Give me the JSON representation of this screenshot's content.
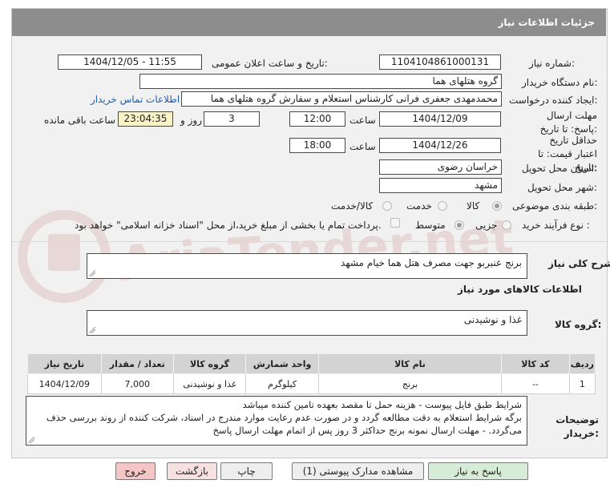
{
  "header": {
    "title": "جزئیات اطلاعات نیاز"
  },
  "fields": {
    "need_number": {
      "label": "شماره نیاز:",
      "value": "1104104861000131"
    },
    "announce_datetime": {
      "label": "تاریخ و ساعت اعلان عمومی:",
      "value": "1404/12/05 - 11:55"
    },
    "buyer_org": {
      "label": "نام دستگاه خریدار:",
      "value": "گروه هتلهای هما"
    },
    "requester": {
      "label": "ایجاد کننده درخواست:",
      "value": "محمدمهدی جعفری فرانی کارشناس استعلام و سفارش گروه هتلهای هما",
      "contact_link": "اطلاعات تماس خریدار"
    },
    "deadline": {
      "label": "مهلت ارسال پاسخ: تا تاریخ:",
      "date": "1404/12/09",
      "time_label": "ساعت",
      "time": "12:00",
      "days": "3",
      "days_label": "روز و",
      "remaining": "23:04:35",
      "remaining_label": "ساعت باقی مانده"
    },
    "price_validity": {
      "label": "حداقل تاریخ اعتبار قیمت: تا تاریخ:",
      "date": "1404/12/26",
      "time_label": "ساعت",
      "time": "18:00"
    },
    "province": {
      "label": "استان محل تحویل:",
      "value": "خراسان رضوی"
    },
    "city": {
      "label": "شهر محل تحویل:",
      "value": "مشهد"
    },
    "category": {
      "label": "طبقه بندی موضوعی:",
      "options": [
        "کالا",
        "خدمت",
        "کالا/خدمت"
      ],
      "selected": "کالا"
    },
    "process": {
      "label": "نوع فرآیند خرید :",
      "options": [
        "جزیی",
        "متوسط"
      ],
      "selected": "جزیی",
      "payment_note": "پرداخت تمام یا بخشی از مبلغ خرید،از محل \"اسناد خزانه اسلامی\" خواهد بود."
    }
  },
  "summary": {
    "label": "شرح کلی نیاز:",
    "value": "برنج عنبربو جهت مصرف هتل هما خیام مشهد"
  },
  "goods_info": {
    "title": "اطلاعات کالاهای مورد نیاز"
  },
  "goods_group": {
    "label": "گروه کالا:",
    "value": "غذا و نوشیدنی"
  },
  "items_table": {
    "headers": [
      "ردیف",
      "کد کالا",
      "نام کالا",
      "واحد شمارش",
      "گروه کالا",
      "تعداد / مقدار",
      "تاریخ نیاز"
    ],
    "rows": [
      [
        "1",
        "--",
        "برنج",
        "کیلوگرم",
        "غذا و نوشیدنی",
        "7,000",
        "1404/12/09"
      ]
    ]
  },
  "buyer_notes": {
    "label": "توضیحات خریدار:",
    "lines": [
      "شرایط طبق فایل پیوست - هزینه حمل تا مقصد بعهده تامین کننده میباشد",
      "برگه شرایط استعلام به دقت مطالعه گردد و در صورت عدم رعایت موارد مندرج در اسناد، شرکت کننده از روند بررسی حذف",
      "می‌گردد. - مهلت ارسال نمونه برنج حداکثر 3 روز پس از اتمام مهلت ارسال پاسخ"
    ]
  },
  "buttons": {
    "reply": "پاسخ به نیاز",
    "attachments": "مشاهده مدارک پیوستی (1)",
    "print": "چاپ",
    "back": "بازگشت",
    "exit": "خروج"
  },
  "colors": {
    "header_bg": "#8d8d8d",
    "link": "#1a5fb4",
    "remaining_bg": "#f7f2c8",
    "exit_bg": "#f5c6c6",
    "reply_bg": "#d6ecd6"
  }
}
